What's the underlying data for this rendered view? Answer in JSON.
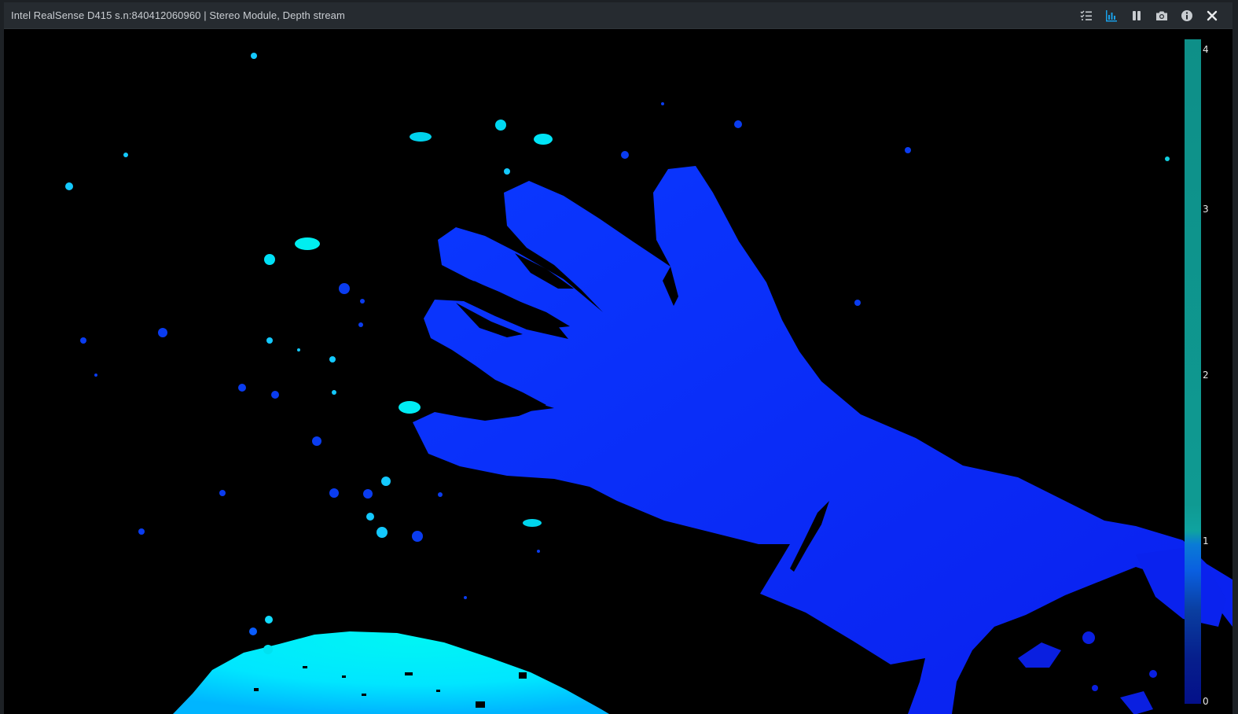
{
  "window": {
    "title": "Intel RealSense D415 s.n:840412060960 | Stereo Module, Depth stream"
  },
  "toolbar": {
    "buttons": [
      {
        "name": "list-icon",
        "active": false
      },
      {
        "name": "histogram-icon",
        "active": true
      },
      {
        "name": "pause-icon",
        "active": false
      },
      {
        "name": "camera-icon",
        "active": false
      },
      {
        "name": "info-icon",
        "active": false
      },
      {
        "name": "close-icon",
        "active": false
      }
    ],
    "colors": {
      "normal": "#c8ccd0",
      "active": "#1a9fe6"
    }
  },
  "colorbar": {
    "ticks": [
      "4",
      "3",
      "2",
      "1",
      "0"
    ]
  },
  "depth_colors": {
    "near": "#0a1cf0",
    "mid": "#0a3dff",
    "far": "#00f0ff",
    "speck": "#14c9ff"
  }
}
